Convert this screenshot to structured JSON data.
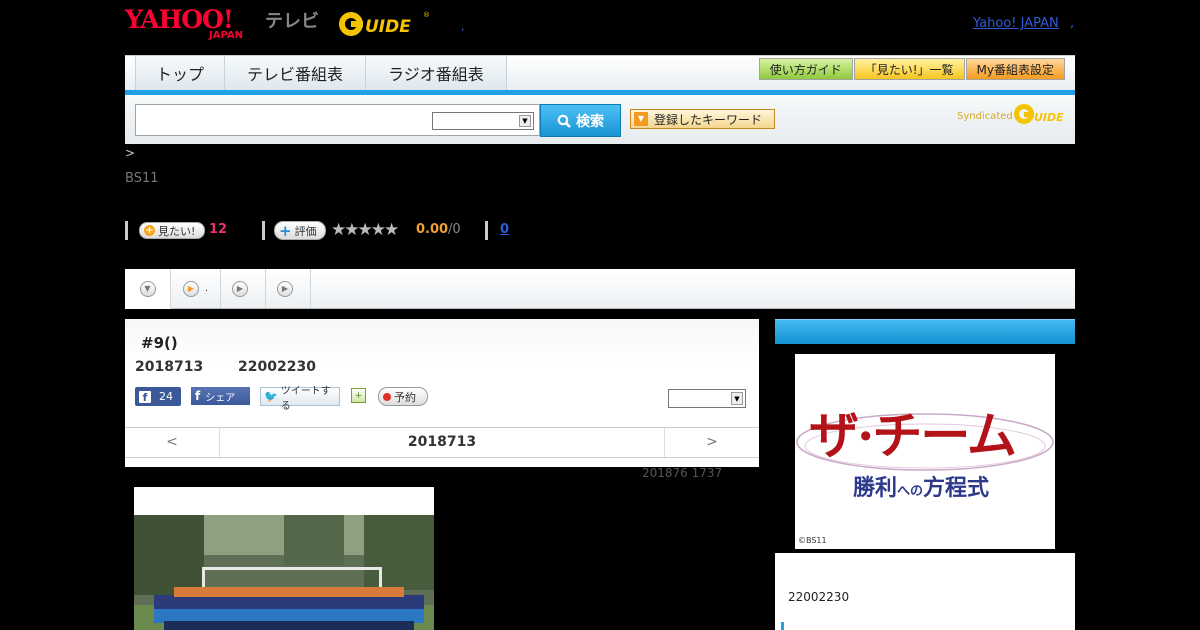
{
  "header": {
    "yahoo_logo": "YAHOO!",
    "yahoo_japan": "JAPAN",
    "tv_label": "テレビ",
    "gguide_logo": "G GUIDE",
    "sep": ",",
    "top_link": "Yahoo! JAPAN",
    "top_link_sep": ","
  },
  "nav": {
    "tabs": [
      "トップ",
      "テレビ番組表",
      "ラジオ番組表"
    ],
    "right_buttons": [
      "使い方ガイド",
      "「見たい!」一覧",
      "My番組表設定"
    ]
  },
  "search": {
    "placeholder": "",
    "select_value": "",
    "button_label": "検索",
    "keyword_button": "登録したキーワード",
    "syndicated": "Syndicated"
  },
  "breadcrumb": ">",
  "channel": "BS11",
  "stats": {
    "mitai_label": "見たい!",
    "mitai_count": "12",
    "hyoka_label": "評価",
    "stars": "★★★★★",
    "rating_fraction": 0,
    "score": "0.00",
    "out_of": "/0",
    "reviews": "0"
  },
  "subtabs": [
    ".",
    "",
    ""
  ],
  "program": {
    "title": "#9()",
    "date": "2018713",
    "time": "22002230",
    "fb_count": "24",
    "fb_share": "シェア",
    "tweet": "ツイートする",
    "reserve": "予約",
    "select_value": ""
  },
  "date_nav": {
    "prev": "<",
    "label": "2018713",
    "next": ">"
  },
  "updated": "201876  1737",
  "sidebar": {
    "poster_title": "ザ·チーム",
    "poster_sub_a": "勝利",
    "poster_sub_b": "への",
    "poster_sub_c": "方程式",
    "poster_credit": "©BS11",
    "time": "22002230"
  },
  "colors": {
    "accent_blue": "#1ea1e6",
    "yahoo_red": "#ff0033",
    "mitai_pink": "#e8306a",
    "score_orange": "#f0a030"
  }
}
